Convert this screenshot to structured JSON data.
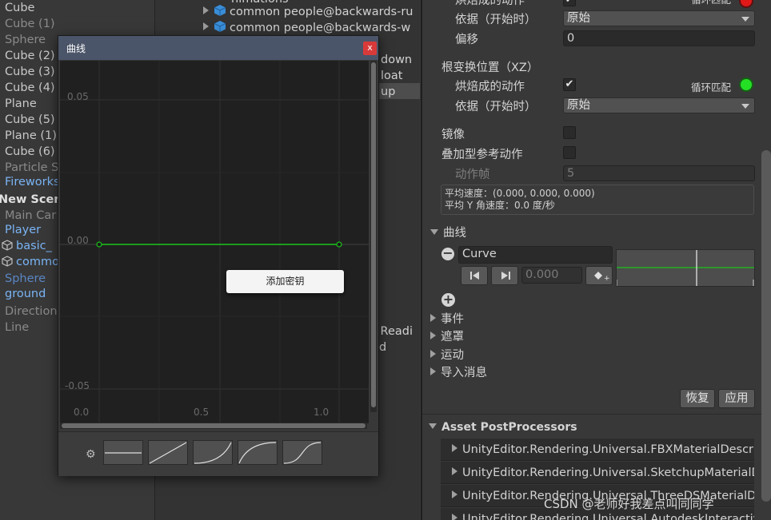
{
  "hierarchy": {
    "items": [
      {
        "label": "Cube",
        "style": "normal"
      },
      {
        "label": "Cube (1)",
        "style": "dim"
      },
      {
        "label": "Sphere",
        "style": "dim"
      },
      {
        "label": "Cube (2)",
        "style": "normal"
      },
      {
        "label": "Cube (3)",
        "style": "normal"
      },
      {
        "label": "Cube (4)",
        "style": "normal"
      },
      {
        "label": "Plane",
        "style": "normal"
      },
      {
        "label": "Cube (5)",
        "style": "normal"
      },
      {
        "label": "Plane (1)",
        "style": "normal"
      },
      {
        "label": "Cube (6)",
        "style": "normal"
      },
      {
        "label": "Particle S",
        "style": "dim"
      },
      {
        "label": "Fireworks",
        "style": "blue"
      },
      {
        "label": "New Scene",
        "style": "bold"
      },
      {
        "label": "Main Car",
        "style": "dim"
      },
      {
        "label": "Player",
        "style": "blue"
      },
      {
        "label": "basic_",
        "style": "blue-child"
      },
      {
        "label": "commo",
        "style": "blue-child"
      },
      {
        "label": "Sphere",
        "style": "blue-dim"
      },
      {
        "label": "ground",
        "style": "blue"
      },
      {
        "label": "Direction",
        "style": "dim"
      },
      {
        "label": "Line",
        "style": "dim"
      }
    ]
  },
  "project": {
    "top_partial": "nimations",
    "items": [
      "common people@backwards-ru",
      "common people@backwards-w"
    ],
    "right_labels": [
      {
        "text": "down"
      },
      {
        "text": "loat"
      },
      {
        "text": "up"
      },
      {
        "text": "e Readi"
      },
      {
        "text": "d"
      }
    ]
  },
  "inspector": {
    "top_row": {
      "label": "烘焙成的动作",
      "loop_label": "循环匹配",
      "loop_status": "red"
    },
    "based_on_1": {
      "label": "依据（开始时）",
      "value": "原始"
    },
    "offset": {
      "label": "偏移",
      "value": "0"
    },
    "root_xz": {
      "label": "根变换位置（XZ）"
    },
    "baked": {
      "label": "烘焙成的动作",
      "checked": "✔",
      "loop_label": "循环匹配",
      "loop_status": "green"
    },
    "based_on_2": {
      "label": "依据（开始时）",
      "value": "原始"
    },
    "mirror": {
      "label": "镜像"
    },
    "additive": {
      "label": "叠加型参考动作"
    },
    "frame": {
      "label": "动作帧",
      "value": "5"
    },
    "info": {
      "line1": "平均速度：(0.000, 0.000, 0.000)",
      "line2": "平均 Y 角速度：0.0 度/秒"
    },
    "curves": {
      "header": "曲线",
      "curve_name": "Curve",
      "value": "0.000",
      "remove_glyph": "−",
      "add_glyph": "+"
    },
    "sections": [
      "事件",
      "遮罩",
      "运动",
      "导入消息"
    ],
    "revert_label": "恢复",
    "apply_label": "应用",
    "postprocessors": {
      "header": "Asset PostProcessors",
      "items": [
        "UnityEditor.Rendering.Universal.FBXMaterialDescri",
        "UnityEditor.Rendering.Universal.SketchupMaterialD",
        "UnityEditor.Rendering.Universal.ThreeDSMaterialD",
        "UnityEditor.Rendering.Universal.AutodeskInteractiv"
      ]
    },
    "watermark": "CSDN @老师好我差点叫同同学"
  },
  "curve_window": {
    "title": "曲线",
    "close_glyph": "x",
    "y_labels": [
      "0.05",
      "0.00",
      "-0.05"
    ],
    "x_labels": [
      "0.0",
      "0.5",
      "1.0"
    ],
    "context_menu_item": "添加密钥",
    "gear_glyph": "⚙",
    "line_color": "#19c419"
  }
}
